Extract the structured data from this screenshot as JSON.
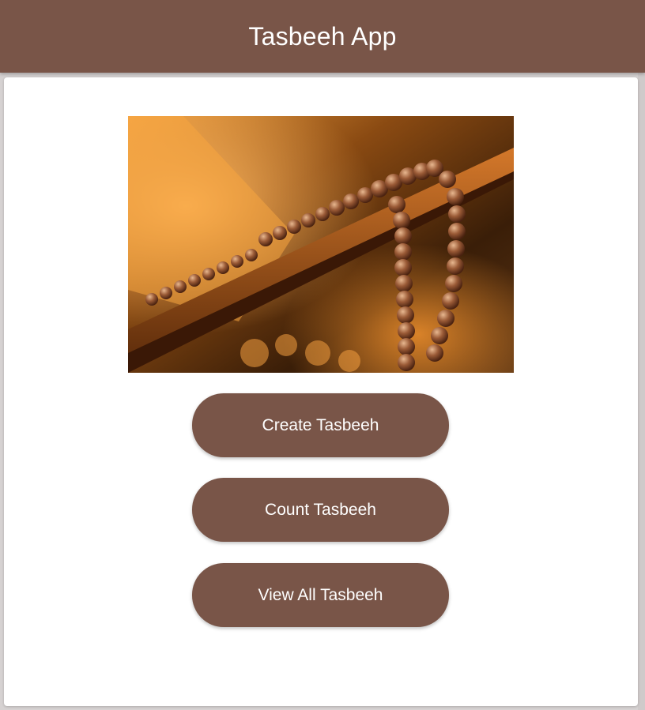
{
  "header": {
    "title": "Tasbeeh App"
  },
  "hero_image": {
    "icon": "prayer-beads-image"
  },
  "actions": {
    "create_label": "Create Tasbeeh",
    "count_label": "Count Tasbeeh",
    "view_all_label": "View All Tasbeeh"
  },
  "colors": {
    "primary": "#795548",
    "on_primary": "#ffffff",
    "surface": "#ffffff",
    "background": "#d6d2d2"
  }
}
